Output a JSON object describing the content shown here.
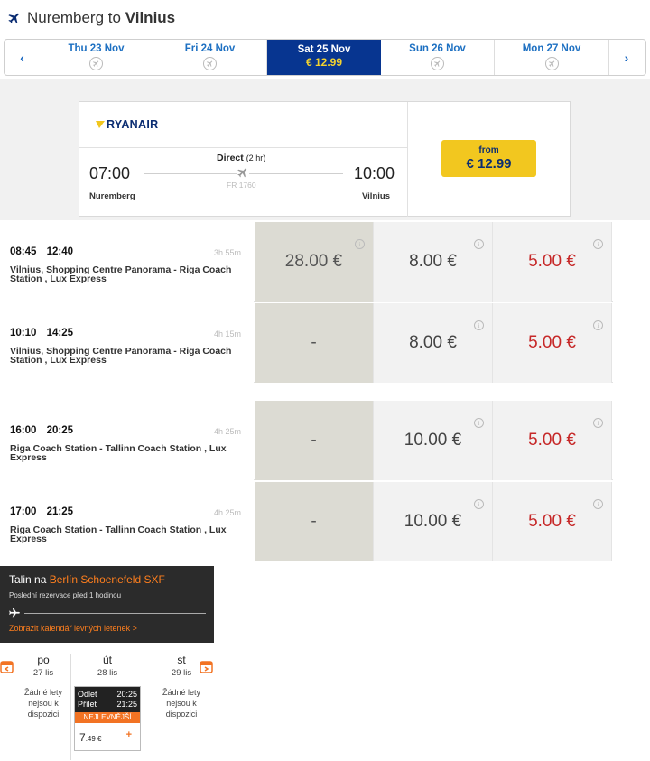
{
  "header": {
    "from": "Nuremberg",
    "connector": "to",
    "to": "Vilnius"
  },
  "datebar": {
    "prev": "‹",
    "next": "›",
    "days": [
      {
        "label": "Thu 23 Nov"
      },
      {
        "label": "Fri 24 Nov"
      },
      {
        "label": "Sat 25 Nov",
        "price": "€ 12.99"
      },
      {
        "label": "Sun 26 Nov"
      },
      {
        "label": "Mon 27 Nov"
      }
    ]
  },
  "flight": {
    "airline": "RYANAIR",
    "direct": "Direct",
    "duration": "(2 hr)",
    "dep_time": "07:00",
    "arr_time": "10:00",
    "dep_city": "Nuremberg",
    "arr_city": "Vilnius",
    "flight_no": "FR 1760",
    "from_label": "from",
    "price": "€ 12.99"
  },
  "trips": [
    {
      "dep": "08:45",
      "arr": "12:40",
      "dur": "3h 55m",
      "route": "Vilnius, Shopping Centre Panorama - Riga Coach Station , Lux Express",
      "p1": "28.00 €",
      "p2": "8.00 €",
      "p3": "5.00 €"
    },
    {
      "dep": "10:10",
      "arr": "14:25",
      "dur": "4h 15m",
      "route": "Vilnius, Shopping Centre Panorama - Riga Coach Station , Lux Express",
      "p1": "-",
      "p2": "8.00 €",
      "p3": "5.00 €"
    },
    {
      "dep": "16:00",
      "arr": "20:25",
      "dur": "4h 25m",
      "route": "Riga Coach Station - Tallinn Coach Station , Lux Express",
      "p1": "-",
      "p2": "10.00 €",
      "p3": "5.00 €"
    },
    {
      "dep": "17:00",
      "arr": "21:25",
      "dur": "4h 25m",
      "route": "Riga Coach Station - Tallinn Coach Station , Lux Express",
      "p1": "-",
      "p2": "10.00 €",
      "p3": "5.00 €"
    }
  ],
  "info_glyph": "i",
  "promo": {
    "title_prefix": "Talin na",
    "title_dest": "Berlín Schoenefeld SXF",
    "subtitle": "Poslední rezervace před 1 hodinou",
    "link": "Zobrazit kalendář levných letenek >"
  },
  "calendar": {
    "days": [
      {
        "name": "po",
        "date": "27 lis",
        "none": [
          "Žádné lety",
          "nejsou k",
          "dispozici"
        ]
      },
      {
        "name": "út",
        "date": "28 lis"
      },
      {
        "name": "st",
        "date": "29 lis",
        "none": [
          "Žádné lety",
          "nejsou k",
          "dispozici"
        ]
      }
    ],
    "selected": {
      "dep_label": "Odlet",
      "dep_time": "20:25",
      "arr_label": "Přílet",
      "arr_time": "21:25",
      "badge": "NEJLEVNĚJŠÍ",
      "price_main": "7",
      "price_dec": ".49 €",
      "plus": "+"
    }
  },
  "colors": {
    "primary": "#073590",
    "accent": "#f2c71f",
    "price_red": "#c62828",
    "orange": "#f27323"
  }
}
